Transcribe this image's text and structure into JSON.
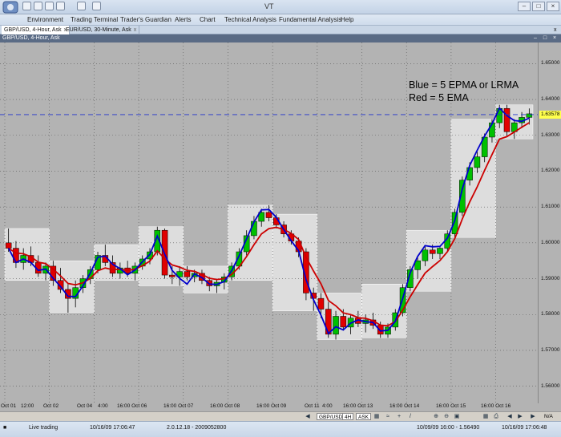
{
  "app": {
    "title": "VT",
    "menu": [
      "Environment",
      "Trading Terminal",
      "Trader's Guardian",
      "Alerts",
      "Chart",
      "Technical Analysis",
      "Fundamental Analysis",
      "Help"
    ],
    "tabs": [
      {
        "label": "GBP/USD, 4-Hour, Ask",
        "active": true
      },
      {
        "label": "EUR/USD, 30-Minute, Ask",
        "active": false
      }
    ],
    "window_title": "GBP/USD, 4-Hour, Ask"
  },
  "chart_data": {
    "type": "candlestick",
    "symbol": "GBP/USD",
    "timeframe": "4H",
    "side": "Ask",
    "annotations": [
      "Blue =  5 EPMA or LRMA",
      "Red =   5 EMA"
    ],
    "indicators": [
      {
        "name": "5 EPMA or LRMA",
        "color": "#0000cc"
      },
      {
        "name": "5 EMA",
        "color": "#cc0000"
      }
    ],
    "ylim": [
      1.555,
      1.655
    ],
    "y_ticks": [
      "1.65000",
      "1.64000",
      "1.63000",
      "1.62000",
      "1.61000",
      "1.60000",
      "1.59000",
      "1.58000",
      "1.57000",
      "1.56000"
    ],
    "current_price": "1.63578",
    "x_ticks": [
      "Oct 01",
      "12:00",
      "Oct 02",
      "Oct 04",
      "4:00",
      "16:00 Oct 06",
      "16:00 Oct 07",
      "16:00 Oct 08",
      "16:00 Oct 09",
      "Oct 11",
      "4:00",
      "16:00 Oct 13",
      "16:00 Oct 14",
      "16:00 Oct 15",
      "16:00 Oct 16"
    ],
    "candles": [
      [
        1.6,
        1.604,
        1.5975,
        1.5985
      ],
      [
        1.5985,
        1.6005,
        1.593,
        1.5945
      ],
      [
        1.5945,
        1.5985,
        1.5925,
        1.5965
      ],
      [
        1.5965,
        1.599,
        1.5935,
        1.5945
      ],
      [
        1.5945,
        1.5965,
        1.5905,
        1.5915
      ],
      [
        1.5915,
        1.5945,
        1.5895,
        1.5935
      ],
      [
        1.5935,
        1.595,
        1.588,
        1.5895
      ],
      [
        1.5895,
        1.593,
        1.586,
        1.587
      ],
      [
        1.587,
        1.5885,
        1.5805,
        1.5845
      ],
      [
        1.5845,
        1.5895,
        1.582,
        1.5875
      ],
      [
        1.5875,
        1.591,
        1.586,
        1.59
      ],
      [
        1.59,
        1.5935,
        1.5885,
        1.5925
      ],
      [
        1.5925,
        1.5975,
        1.5915,
        1.5965
      ],
      [
        1.5965,
        1.5995,
        1.5935,
        1.5945
      ],
      [
        1.5945,
        1.5965,
        1.5905,
        1.5915
      ],
      [
        1.5915,
        1.5945,
        1.59,
        1.593
      ],
      [
        1.593,
        1.595,
        1.5905,
        1.5915
      ],
      [
        1.5915,
        1.5945,
        1.5895,
        1.5935
      ],
      [
        1.5935,
        1.5965,
        1.5925,
        1.5955
      ],
      [
        1.5955,
        1.5985,
        1.594,
        1.5975
      ],
      [
        1.5975,
        1.6045,
        1.5965,
        1.6035
      ],
      [
        1.6035,
        1.604,
        1.59,
        1.591
      ],
      [
        1.591,
        1.5935,
        1.5885,
        1.5905
      ],
      [
        1.5905,
        1.5935,
        1.588,
        1.592
      ],
      [
        1.592,
        1.5935,
        1.5895,
        1.5905
      ],
      [
        1.5905,
        1.5925,
        1.589,
        1.5915
      ],
      [
        1.5915,
        1.5925,
        1.5885,
        1.5895
      ],
      [
        1.5895,
        1.5905,
        1.5865,
        1.588
      ],
      [
        1.588,
        1.59,
        1.586,
        1.589
      ],
      [
        1.589,
        1.5915,
        1.587,
        1.5905
      ],
      [
        1.5905,
        1.5945,
        1.5895,
        1.5935
      ],
      [
        1.5935,
        1.5985,
        1.5925,
        1.5975
      ],
      [
        1.5975,
        1.6035,
        1.5965,
        1.602
      ],
      [
        1.602,
        1.6075,
        1.601,
        1.606
      ],
      [
        1.606,
        1.6095,
        1.6045,
        1.6085
      ],
      [
        1.6085,
        1.6105,
        1.606,
        1.607
      ],
      [
        1.607,
        1.608,
        1.604,
        1.605
      ],
      [
        1.605,
        1.606,
        1.6015,
        1.6025
      ],
      [
        1.6025,
        1.6035,
        1.5995,
        1.6005
      ],
      [
        1.6005,
        1.6015,
        1.596,
        1.5975
      ],
      [
        1.5975,
        1.5985,
        1.584,
        1.586
      ],
      [
        1.586,
        1.5875,
        1.581,
        1.5845
      ],
      [
        1.5845,
        1.586,
        1.579,
        1.5815
      ],
      [
        1.5815,
        1.5835,
        1.5735,
        1.5745
      ],
      [
        1.5745,
        1.581,
        1.573,
        1.5795
      ],
      [
        1.5795,
        1.5815,
        1.5755,
        1.5765
      ],
      [
        1.5765,
        1.58,
        1.5745,
        1.579
      ],
      [
        1.579,
        1.581,
        1.5765,
        1.5775
      ],
      [
        1.5775,
        1.58,
        1.575,
        1.5785
      ],
      [
        1.5785,
        1.5805,
        1.576,
        1.577
      ],
      [
        1.577,
        1.578,
        1.5735,
        1.5745
      ],
      [
        1.5745,
        1.5775,
        1.5735,
        1.5765
      ],
      [
        1.5765,
        1.5815,
        1.5755,
        1.5805
      ],
      [
        1.5805,
        1.5885,
        1.5795,
        1.5875
      ],
      [
        1.5875,
        1.5935,
        1.5865,
        1.5925
      ],
      [
        1.5925,
        1.596,
        1.59,
        1.595
      ],
      [
        1.595,
        1.599,
        1.5935,
        1.598
      ],
      [
        1.598,
        1.5995,
        1.5955,
        1.597
      ],
      [
        1.597,
        1.599,
        1.5955,
        1.5985
      ],
      [
        1.5985,
        1.6035,
        1.5975,
        1.6025
      ],
      [
        1.6025,
        1.6095,
        1.6015,
        1.6085
      ],
      [
        1.6085,
        1.6185,
        1.6075,
        1.6175
      ],
      [
        1.6175,
        1.6225,
        1.616,
        1.621
      ],
      [
        1.621,
        1.6255,
        1.6195,
        1.624
      ],
      [
        1.624,
        1.6305,
        1.6225,
        1.6295
      ],
      [
        1.6295,
        1.6345,
        1.628,
        1.6335
      ],
      [
        1.6335,
        1.6385,
        1.632,
        1.6375
      ],
      [
        1.6375,
        1.6385,
        1.6295,
        1.631
      ],
      [
        1.631,
        1.6345,
        1.629,
        1.6335
      ],
      [
        1.6335,
        1.6365,
        1.632,
        1.635
      ],
      [
        1.635,
        1.6375,
        1.633,
        1.636
      ]
    ]
  },
  "toolbar": {
    "symbol": "GBP/USD",
    "timeframe": "4H",
    "side": "ASK",
    "zoom": "N/A"
  },
  "status": {
    "live": "Live trading",
    "datetime": "10/16/09 17:06:47",
    "version": "2.0.12.18 - 2009052800",
    "cursor": "10/09/09 16:00 - 1.56490",
    "datetime2": "10/16/09 17:06:48"
  }
}
